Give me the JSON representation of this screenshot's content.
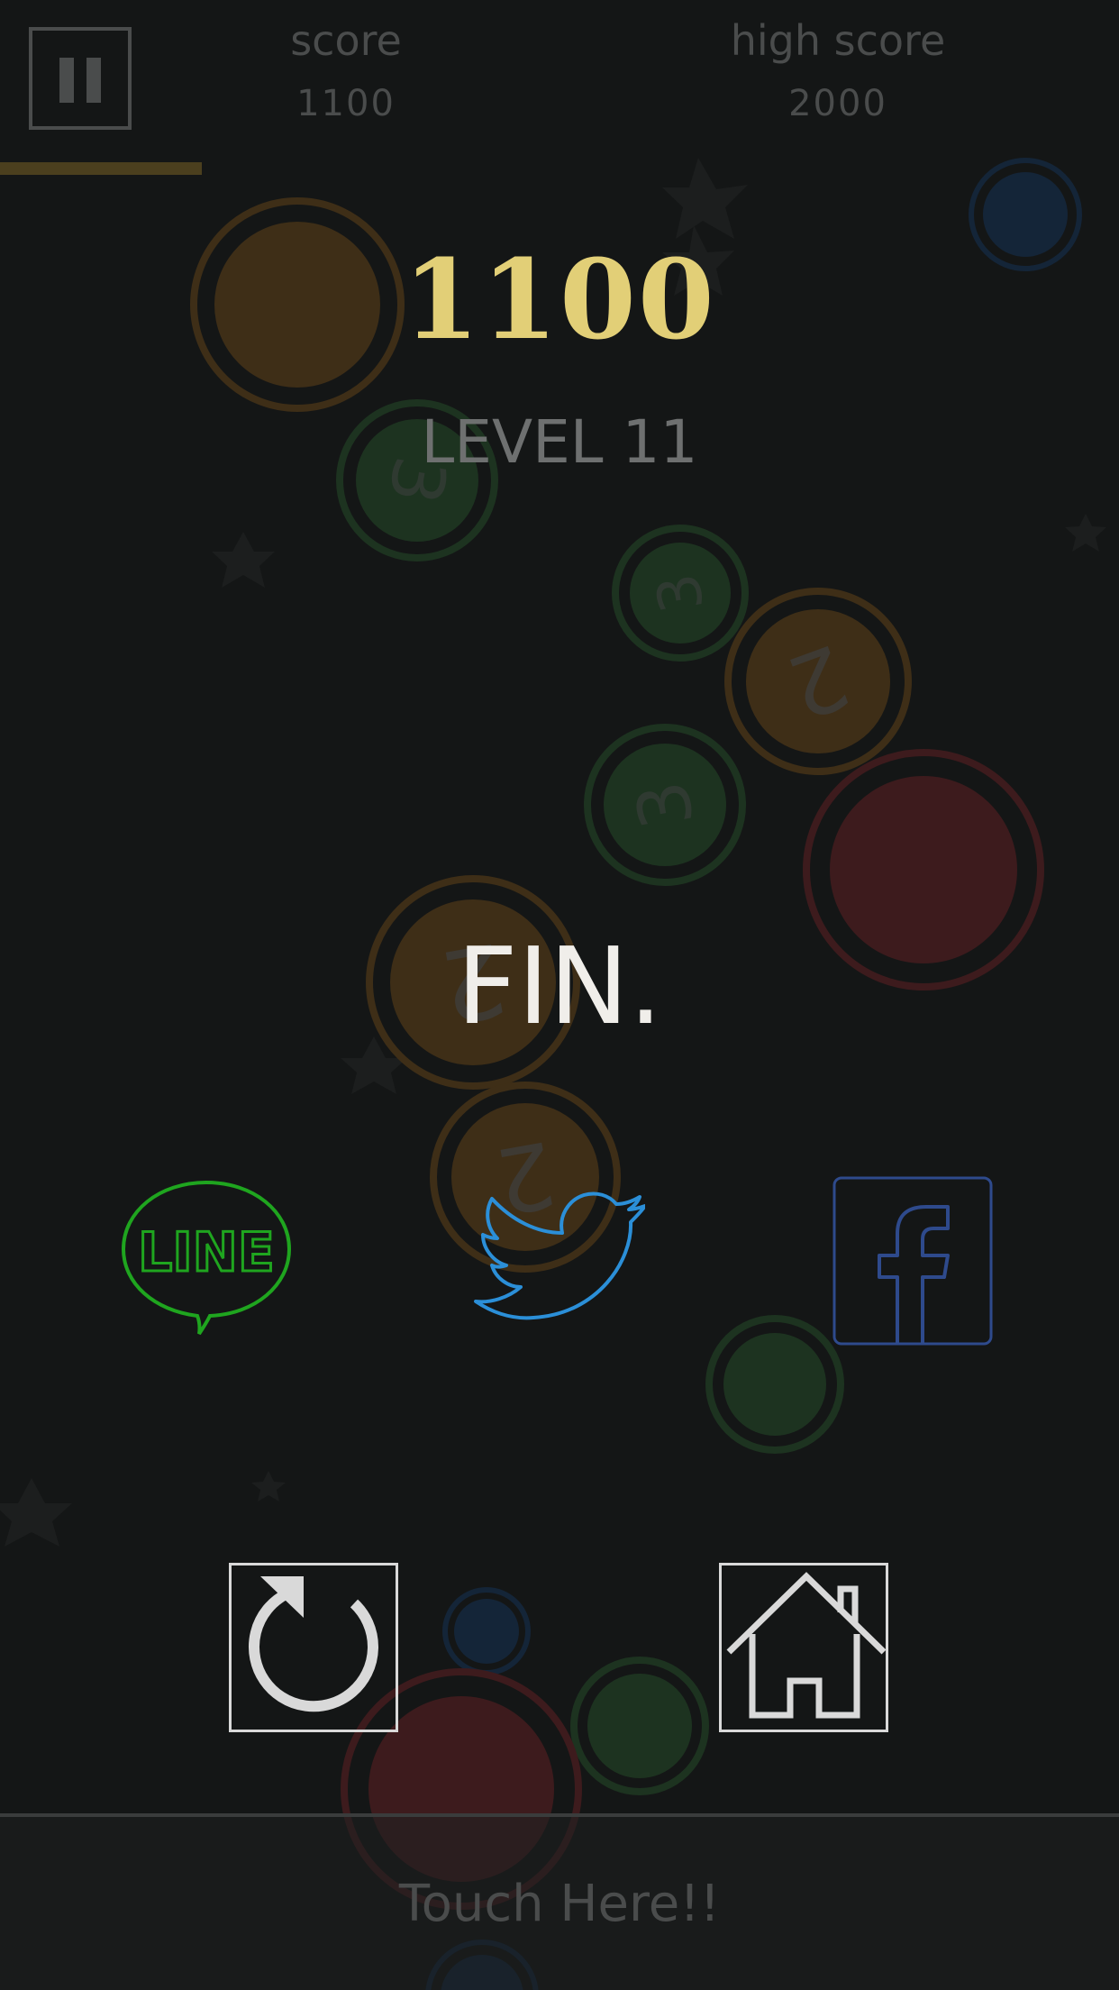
{
  "hud": {
    "score_label": "score",
    "score_value": "1100",
    "high_score_label": "high score",
    "high_score_value": "2000",
    "progress_fraction": 0.18
  },
  "result": {
    "final_score": "1100",
    "level": "LEVEL 11",
    "message": "FIN."
  },
  "share": {
    "line_text": "LINE",
    "facebook_glyph": "f"
  },
  "footer": {
    "touch_label": "Touch Here!!"
  },
  "colors": {
    "background": "#141616",
    "gold": "#e2cf77",
    "line_green": "#1fa51f",
    "twitter_blue": "#2b8fd8",
    "facebook_blue": "#2e4a8c",
    "orb_orange": "#3e2e17",
    "orb_green": "#1d3320",
    "orb_red": "#3d1b1d",
    "orb_blue": "#142538"
  },
  "bubbles": [
    {
      "color": "orange",
      "number": ""
    },
    {
      "color": "green",
      "number": "3"
    },
    {
      "color": "green",
      "number": "3"
    },
    {
      "color": "orange",
      "number": "2"
    },
    {
      "color": "green",
      "number": "3"
    },
    {
      "color": "red",
      "number": ""
    },
    {
      "color": "orange",
      "number": "2"
    },
    {
      "color": "orange",
      "number": "2"
    },
    {
      "color": "green",
      "number": ""
    },
    {
      "color": "blue",
      "number": ""
    },
    {
      "color": "blue",
      "number": ""
    },
    {
      "color": "green",
      "number": ""
    },
    {
      "color": "red",
      "number": ""
    },
    {
      "color": "blue",
      "number": ""
    }
  ]
}
